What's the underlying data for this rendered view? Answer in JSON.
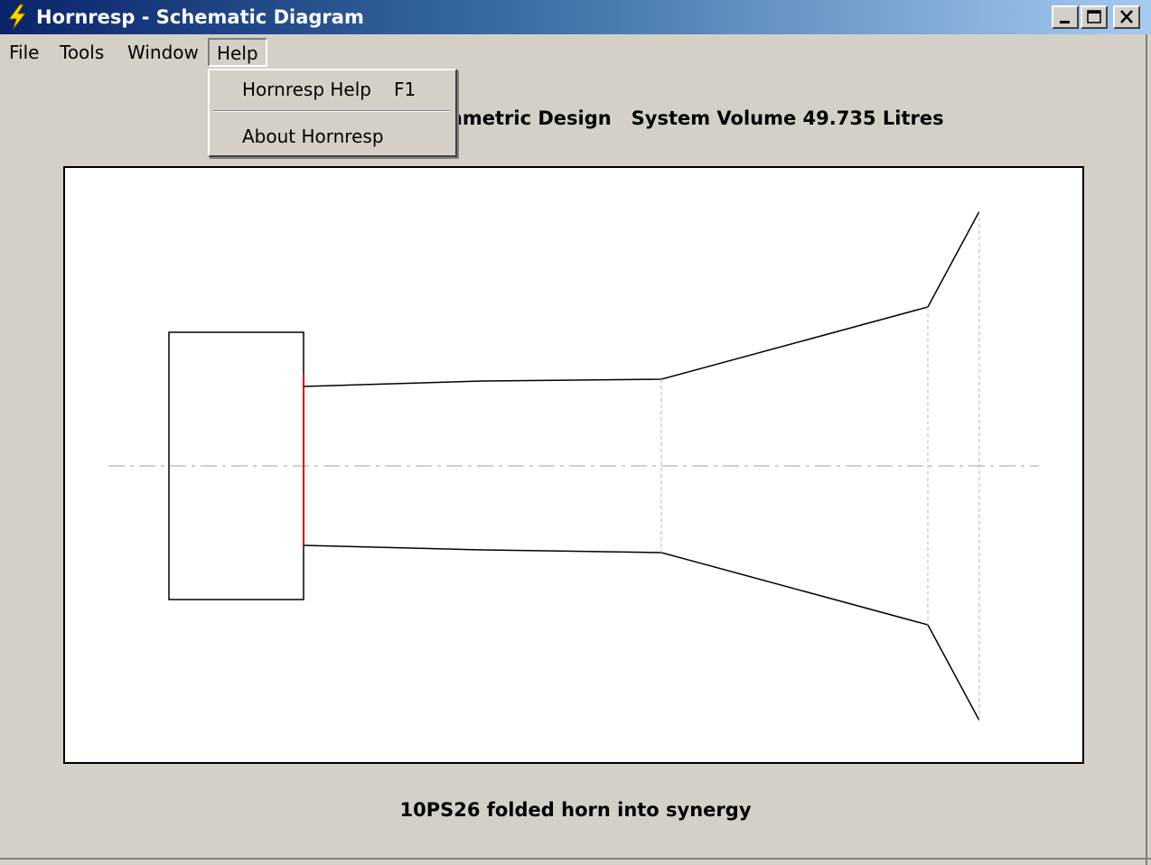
{
  "window": {
    "title": "Hornresp - Schematic Diagram",
    "controls": {
      "minimize": "minimize-icon",
      "maximize": "maximize-icon",
      "close": "close-icon"
    }
  },
  "menubar": {
    "file": "File",
    "tools": "Tools",
    "window": "Window",
    "help": "Help"
  },
  "help_menu": {
    "items": [
      {
        "label": "Hornresp Help",
        "shortcut": "F1"
      },
      {
        "label": "About Hornresp"
      }
    ]
  },
  "heading": {
    "visible_text": "S                              symmetric Design   System Volume 49.735 Litres"
  },
  "diagram": {
    "caption": "10PS26 folded horn into synergy",
    "colors": {
      "outline": "#000000",
      "driver": "#e00000",
      "guides": "#c0c0c0"
    }
  }
}
